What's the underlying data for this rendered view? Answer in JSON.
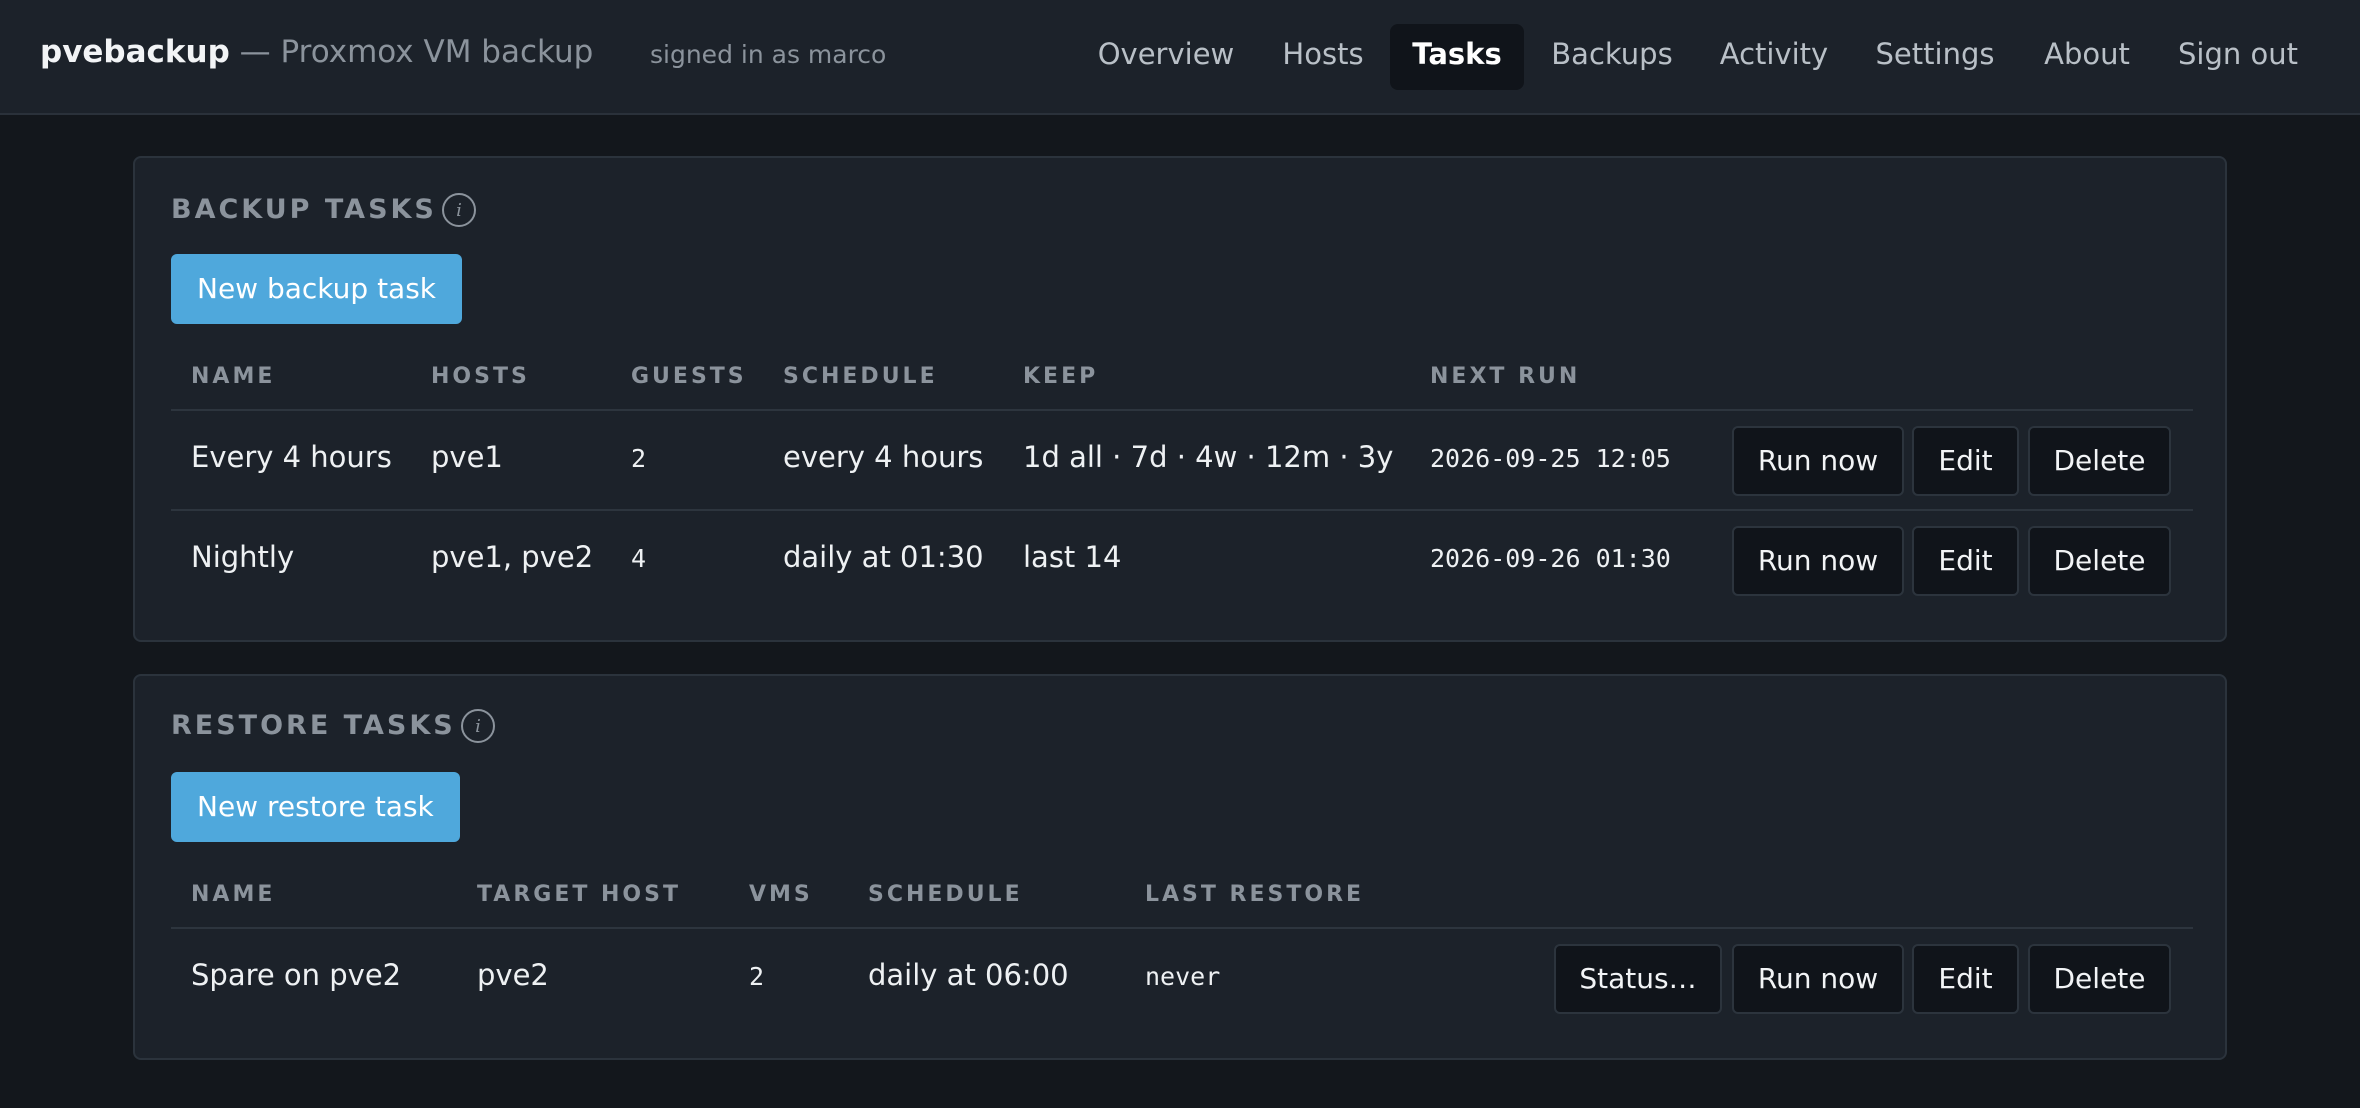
{
  "header": {
    "brand_name": "pvebackup",
    "brand_separator": "—",
    "brand_subtitle": "Proxmox VM backup",
    "signed_in": "signed in as marco",
    "nav": [
      {
        "label": "Overview",
        "active": false
      },
      {
        "label": "Hosts",
        "active": false
      },
      {
        "label": "Tasks",
        "active": true
      },
      {
        "label": "Backups",
        "active": false
      },
      {
        "label": "Activity",
        "active": false
      },
      {
        "label": "Settings",
        "active": false
      },
      {
        "label": "About",
        "active": false
      },
      {
        "label": "Sign out",
        "active": false
      }
    ]
  },
  "backup_tasks": {
    "title": "BACKUP TASKS",
    "info_icon": "info-icon",
    "new_button": "New backup task",
    "columns": [
      "NAME",
      "HOSTS",
      "GUESTS",
      "SCHEDULE",
      "KEEP",
      "NEXT RUN"
    ],
    "rows": [
      {
        "name": "Every 4 hours",
        "hosts": "pve1",
        "guests": "2",
        "schedule": "every 4 hours",
        "keep": "1d all · 7d · 4w · 12m · 3y",
        "next_run": "2026-09-25 12:05"
      },
      {
        "name": "Nightly",
        "hosts": "pve1, pve2",
        "guests": "4",
        "schedule": "daily at 01:30",
        "keep": "last 14",
        "next_run": "2026-09-26 01:30"
      }
    ],
    "actions": {
      "run": "Run now",
      "edit": "Edit",
      "delete": "Delete"
    }
  },
  "restore_tasks": {
    "title": "RESTORE TASKS",
    "info_icon": "info-icon",
    "new_button": "New restore task",
    "columns": [
      "NAME",
      "TARGET HOST",
      "VMS",
      "SCHEDULE",
      "LAST RESTORE"
    ],
    "rows": [
      {
        "name": "Spare on pve2",
        "target_host": "pve2",
        "vms": "2",
        "schedule": "daily at 06:00",
        "last_restore": "never"
      }
    ],
    "actions": {
      "status": "Status…",
      "run": "Run now",
      "edit": "Edit",
      "delete": "Delete"
    }
  },
  "colors": {
    "accent": "#4fa8dc",
    "background": "#13171c",
    "panel": "#1c222a",
    "muted": "#8b939c"
  }
}
